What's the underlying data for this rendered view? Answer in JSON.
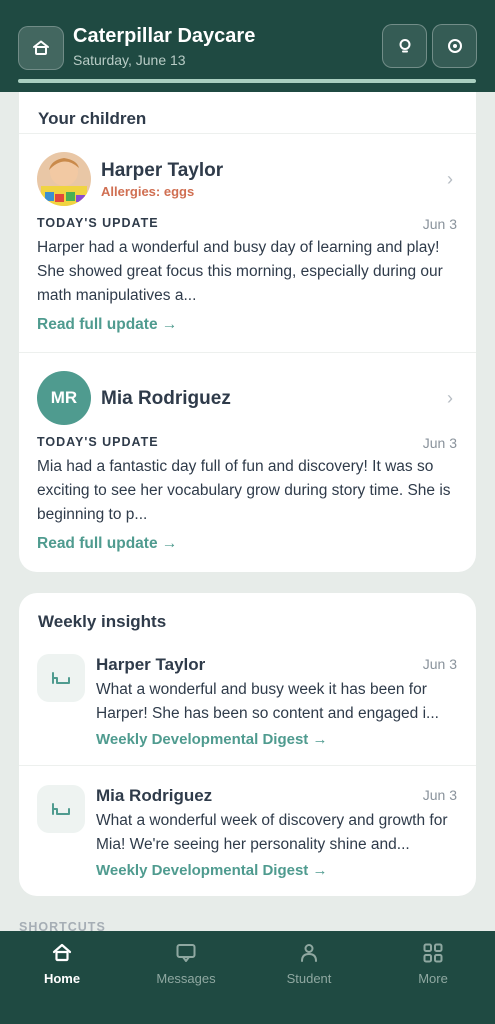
{
  "header": {
    "title": "Caterpillar Daycare",
    "date": "Saturday, June 13"
  },
  "children_section": {
    "title": "Your children",
    "children": [
      {
        "name": "Harper Taylor",
        "allergy": "Allergies: eggs",
        "update_label": "TODAY'S UPDATE",
        "update_date": "Jun 3",
        "update_text": "Harper had a wonderful and busy day of learning and play! She showed great focus this morning, especially during our math manipulatives a...",
        "link": "Read full update →"
      },
      {
        "name": "Mia Rodriguez",
        "initials": "MR",
        "update_label": "TODAY'S UPDATE",
        "update_date": "Jun 3",
        "update_text": "Mia had a fantastic day full of fun and discovery! It was so exciting to see her vocabulary grow during story time. She is beginning to p...",
        "link": "Read full update →"
      }
    ]
  },
  "insights_section": {
    "title": "Weekly insights",
    "items": [
      {
        "name": "Harper Taylor",
        "date": "Jun 3",
        "text": "What a wonderful and busy week it has been for Harper! She has been so content and engaged i...",
        "link": "Weekly Developmental Digest →"
      },
      {
        "name": "Mia Rodriguez",
        "date": "Jun 3",
        "text": "What a wonderful week of discovery and growth for Mia! We're seeing her personality shine and...",
        "link": "Weekly Developmental Digest →"
      }
    ]
  },
  "shortcuts_label": "SHORTCUTS",
  "nav": {
    "items": [
      {
        "label": "Home",
        "icon": "home-icon",
        "active": true
      },
      {
        "label": "Messages",
        "icon": "message-icon",
        "active": false
      },
      {
        "label": "Student",
        "icon": "person-icon",
        "active": false
      },
      {
        "label": "More",
        "icon": "grid-icon",
        "active": false
      }
    ]
  },
  "colors": {
    "header_bg": "#1f4a42",
    "accent": "#4f9b8f",
    "allergy": "#d06f52",
    "page_bg": "#e7ece9"
  }
}
